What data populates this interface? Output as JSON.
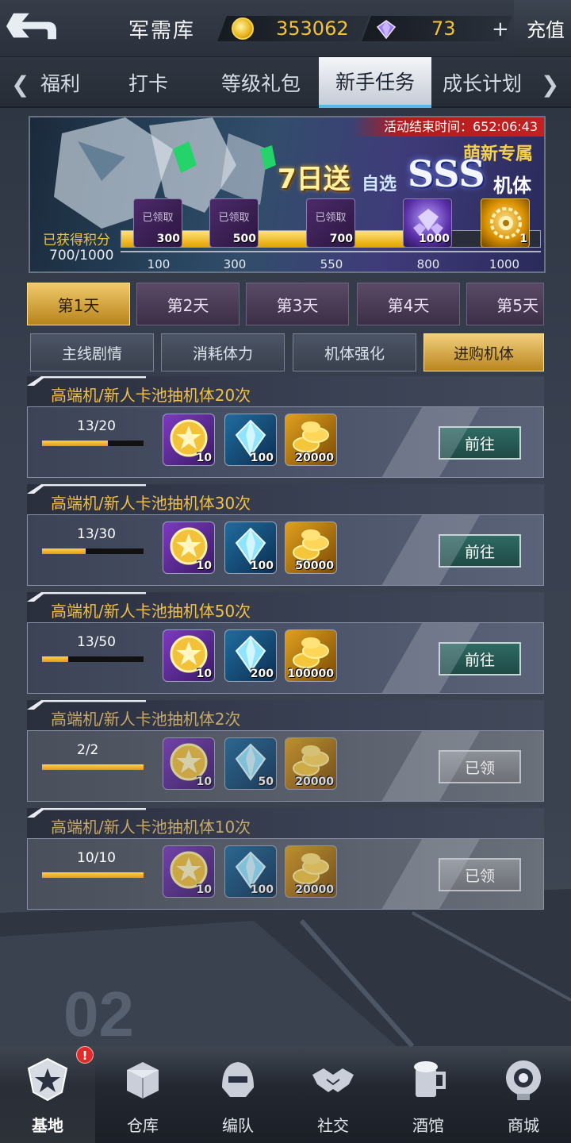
{
  "header": {
    "title": "军需库",
    "coins": "353062",
    "gems": "73",
    "recharge_label": "充值"
  },
  "tabs": [
    {
      "label": "福利"
    },
    {
      "label": "打卡"
    },
    {
      "label": "等级礼包"
    },
    {
      "label": "新手任务"
    },
    {
      "label": "成长计划"
    }
  ],
  "banner": {
    "countdown": "活动结束时间：652:06:43",
    "tag": "萌新专属",
    "headline": "7日送",
    "pick": "自选",
    "sss": "SSS",
    "mecha": "机体",
    "points_label": "已获得积分",
    "points_value": "700/1000",
    "progress_fraction": 0.7,
    "claimed_text": "已领取",
    "milestones": [
      {
        "points": "100",
        "reward_qty": "300",
        "state": "claimed"
      },
      {
        "points": "300",
        "reward_qty": "500",
        "state": "claimed"
      },
      {
        "points": "550",
        "reward_qty": "700",
        "state": "claimed"
      },
      {
        "points": "800",
        "reward_qty": "1000",
        "state": "open"
      },
      {
        "points": "1000",
        "reward_qty": "1",
        "state": "open"
      }
    ]
  },
  "days": [
    "第1天",
    "第2天",
    "第3天",
    "第4天",
    "第5天"
  ],
  "subtabs": [
    "主线剧情",
    "消耗体力",
    "机体强化",
    "进购机体"
  ],
  "tasks": [
    {
      "title": "高端机/新人卡池抽机体20次",
      "progress": "13/20",
      "fraction": 0.65,
      "rewards": [
        "10",
        "100",
        "20000"
      ],
      "button": "前往"
    },
    {
      "title": "高端机/新人卡池抽机体30次",
      "progress": "13/30",
      "fraction": 0.43,
      "rewards": [
        "10",
        "100",
        "50000"
      ],
      "button": "前往"
    },
    {
      "title": "高端机/新人卡池抽机体50次",
      "progress": "13/50",
      "fraction": 0.26,
      "rewards": [
        "10",
        "200",
        "100000"
      ],
      "button": "前往"
    },
    {
      "title": "高端机/新人卡池抽机体2次",
      "progress": "2/2",
      "fraction": 1.0,
      "rewards": [
        "10",
        "50",
        "20000"
      ],
      "button": "已领"
    },
    {
      "title": "高端机/新人卡池抽机体10次",
      "progress": "10/10",
      "fraction": 1.0,
      "rewards": [
        "10",
        "100",
        "20000"
      ],
      "button": "已领"
    }
  ],
  "nav": [
    {
      "label": "基地",
      "alert": "!"
    },
    {
      "label": "仓库"
    },
    {
      "label": "编队"
    },
    {
      "label": "社交"
    },
    {
      "label": "酒馆"
    },
    {
      "label": "商城"
    }
  ],
  "colors": {
    "accent_gold": "#f2c04a",
    "go_button": "#2f6a63",
    "active_tab_underline": "#57b9e8"
  }
}
